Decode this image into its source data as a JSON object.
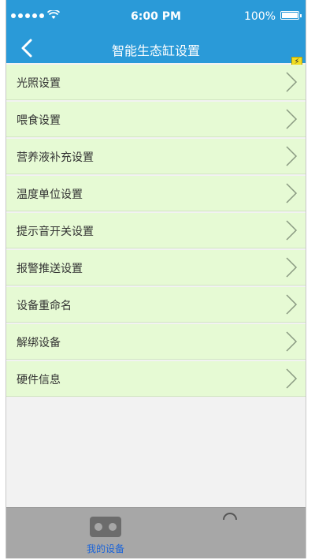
{
  "status_bar": {
    "time": "6:00 PM",
    "battery": "100%",
    "icons": [
      "signal-dots-icon",
      "wifi-icon",
      "battery-icon"
    ]
  },
  "nav": {
    "title": "智能生态缸设置",
    "back_icon": "back-chevron-icon",
    "badge_icon": "lightning-icon"
  },
  "menu": {
    "items": [
      {
        "label": "光照设置"
      },
      {
        "label": "喂食设置"
      },
      {
        "label": "营养液补充设置"
      },
      {
        "label": "温度单位设置"
      },
      {
        "label": "提示音开关设置"
      },
      {
        "label": "报警推送设置"
      },
      {
        "label": "设备重命名"
      },
      {
        "label": "解绑设备"
      },
      {
        "label": "硬件信息"
      }
    ],
    "chevron_icon": "chevron-right-icon"
  },
  "tabbar": {
    "tabs": [
      {
        "label": "我的设备",
        "icon": "device-icon",
        "active": true
      },
      {
        "label": "",
        "icon": "partial-icon",
        "active": false
      }
    ]
  },
  "colors": {
    "header": "#2a9ad8",
    "row": "#e6fad4",
    "tabbar": "#a7a7a7",
    "active_tab": "#1b64d9"
  }
}
